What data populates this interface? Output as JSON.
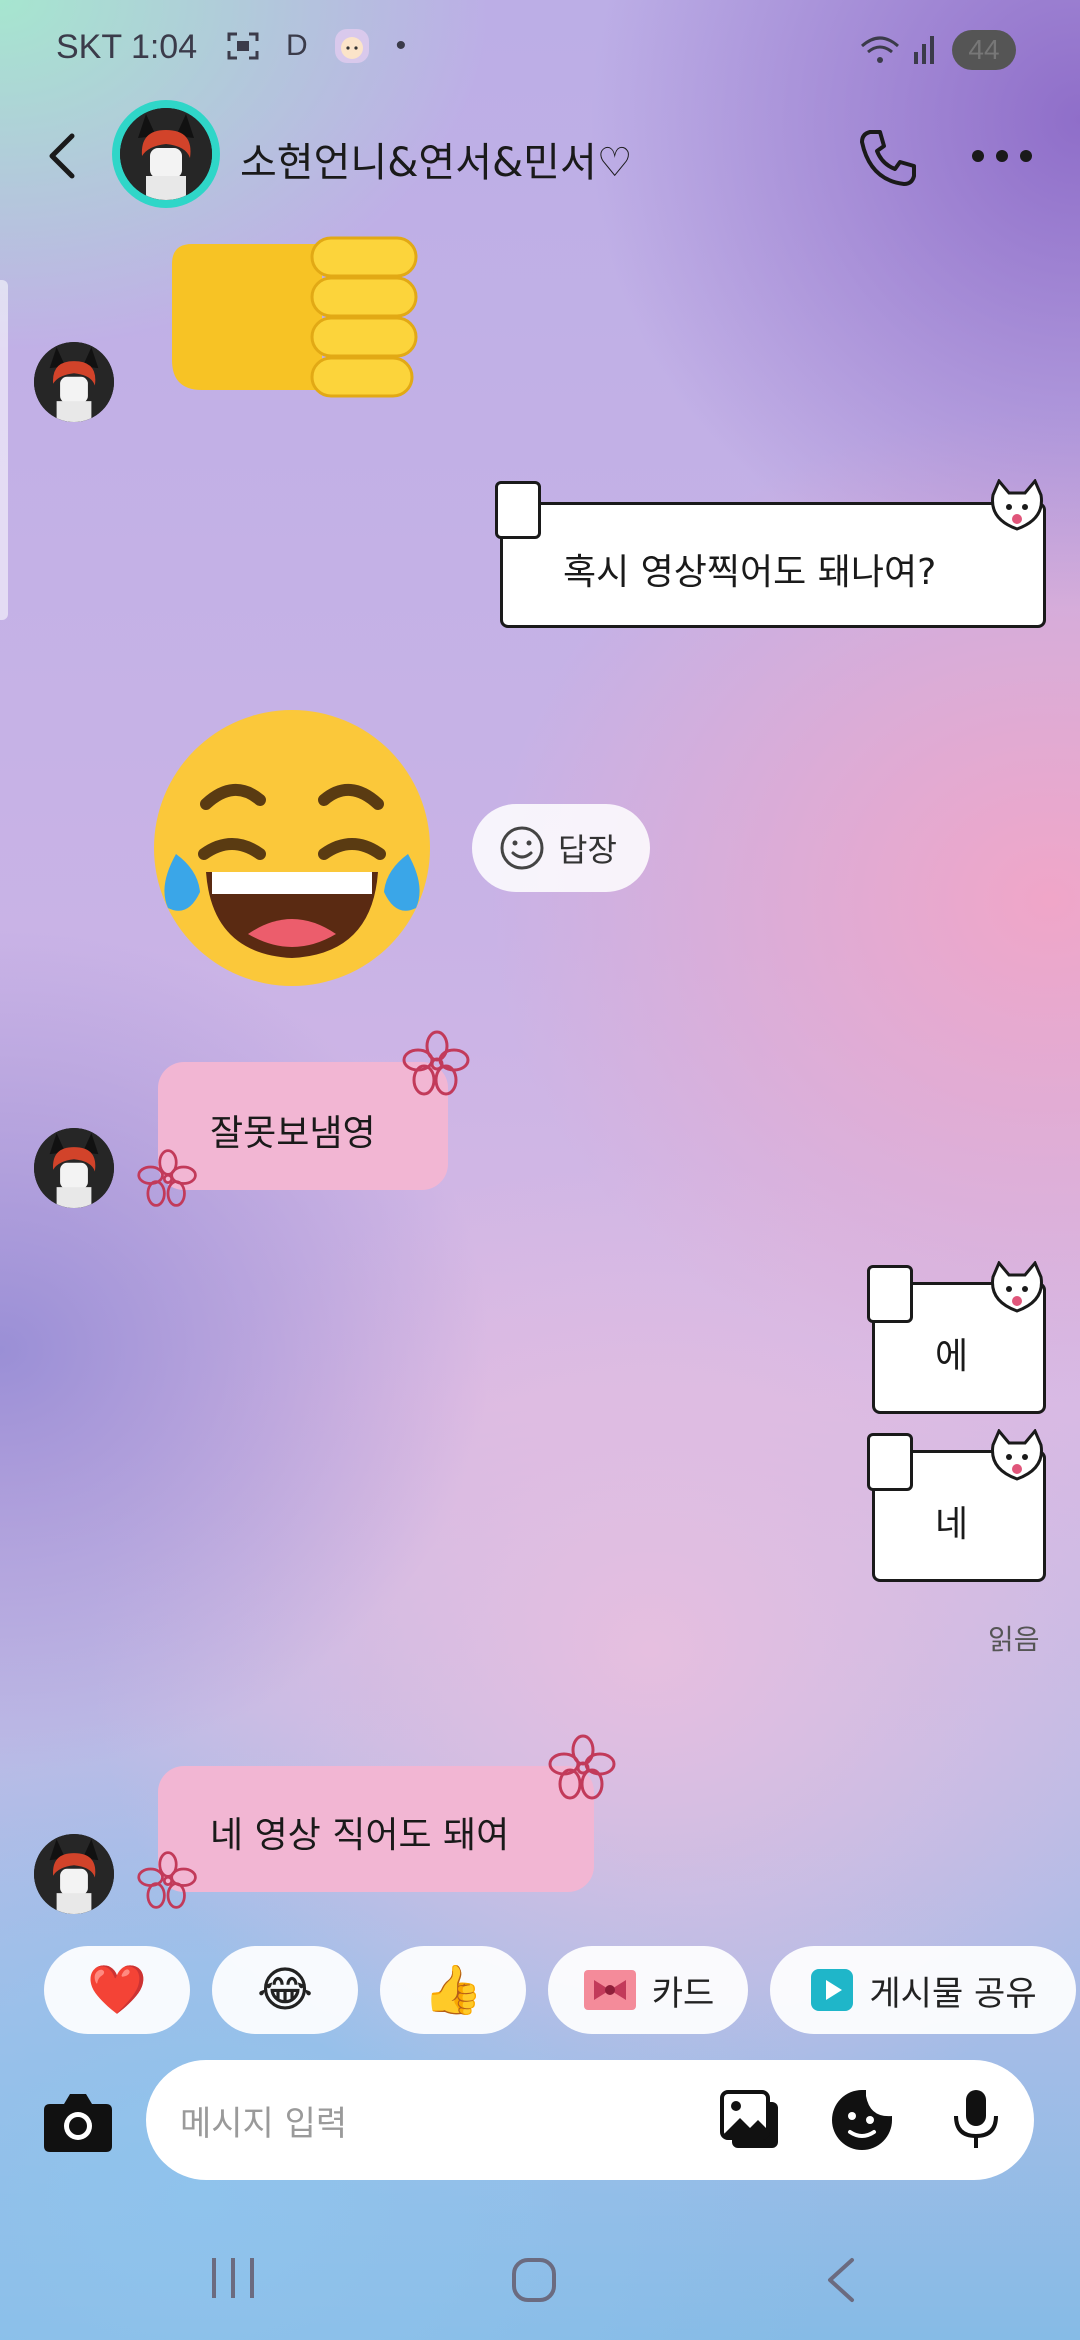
{
  "status_bar": {
    "time": "SKT 1:04",
    "indicators": [
      "screenshot-icon",
      "D",
      "face-icon",
      "•"
    ],
    "battery": "44"
  },
  "header": {
    "back_icon": "chevron-left-icon",
    "title": "소현언니&연서&민서♡",
    "call_icon": "phone-icon",
    "more_icon": "more-dots-icon"
  },
  "messages": [
    {
      "side": "left",
      "type": "emoji",
      "content": "👊"
    },
    {
      "side": "right",
      "type": "text",
      "style": "scroll",
      "text": "혹시 영상찍어도 돼나여?"
    },
    {
      "side": "left",
      "type": "emoji",
      "content": "😂"
    },
    {
      "side": "left",
      "type": "text",
      "style": "pink",
      "text": "잘못보냄영"
    },
    {
      "side": "right",
      "type": "text",
      "style": "scroll",
      "text": "에"
    },
    {
      "side": "right",
      "type": "text",
      "style": "scroll",
      "text": "네"
    },
    {
      "side": "left",
      "type": "text",
      "style": "pink",
      "text": "네 영상 직어도 돼여"
    }
  ],
  "reply_pill": {
    "label": "답장",
    "icon": "smiley-icon"
  },
  "read_receipt": "읽음",
  "quick_reactions": [
    {
      "emoji": "❤️",
      "label": ""
    },
    {
      "emoji": "😂",
      "label": ""
    },
    {
      "emoji": "👍",
      "label": ""
    },
    {
      "emoji": "🎀",
      "label": "카드"
    },
    {
      "emoji": "▶",
      "label": "게시물 공유"
    }
  ],
  "input": {
    "placeholder": "메시지 입력"
  },
  "nav_bar": [
    "recents-icon",
    "home-icon",
    "back-icon"
  ],
  "colors": {
    "pink_bubble": "#f2b6d3",
    "accent_ring": "#2fd6c8"
  }
}
